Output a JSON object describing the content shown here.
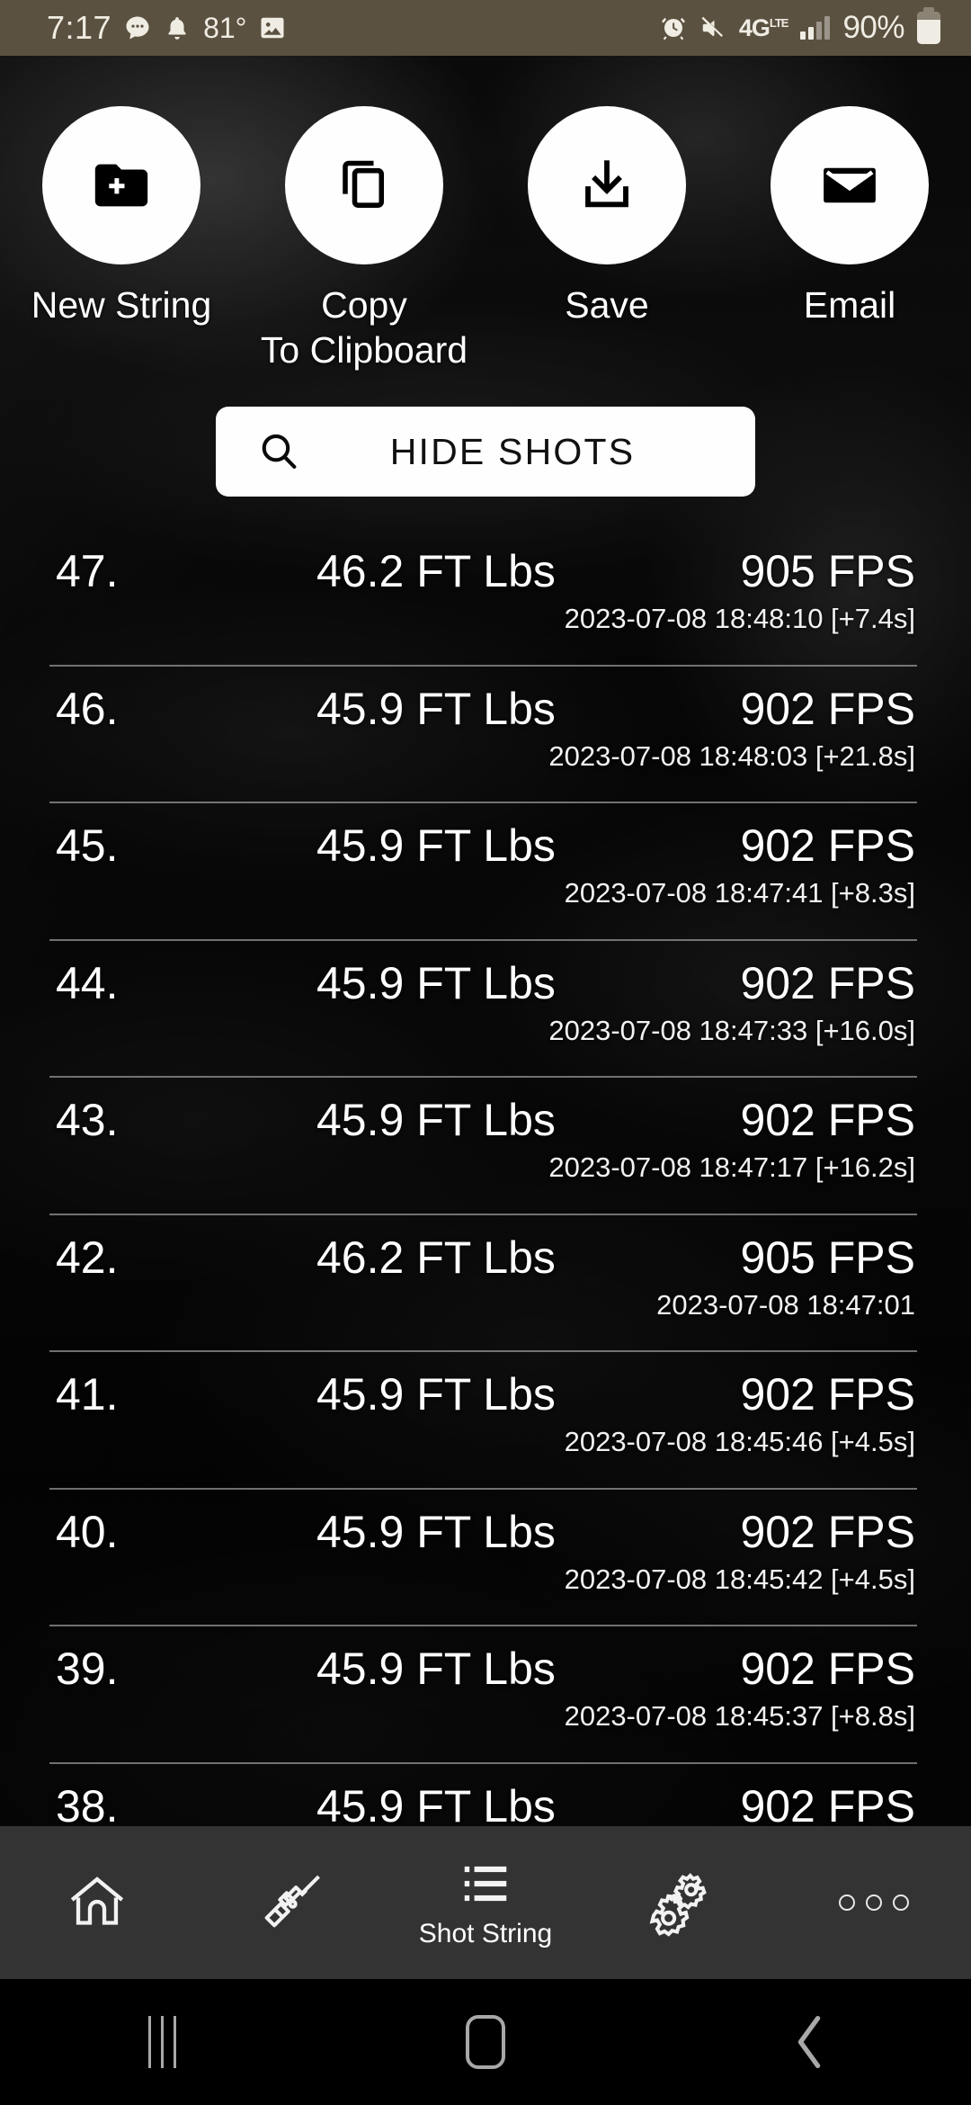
{
  "status_bar": {
    "time": "7:17",
    "temperature": "81°",
    "network": "4G",
    "network_sub": "LTE",
    "battery_percent": "90%",
    "icons": [
      "message-bubble-icon",
      "bell-icon",
      "photo-icon",
      "alarm-clock-icon",
      "mute-icon",
      "signal-bars-icon",
      "battery-icon"
    ],
    "background_color": "#5b5140",
    "text_color": "#efece3"
  },
  "actions": [
    {
      "label": "New String",
      "icon": "folder-plus-icon"
    },
    {
      "label": "Copy\nTo Clipboard",
      "icon": "copy-icon"
    },
    {
      "label": "Save",
      "icon": "download-icon"
    },
    {
      "label": "Email",
      "icon": "envelope-icon"
    }
  ],
  "hide_shots_button": {
    "label": "HIDE SHOTS",
    "icon": "search-icon",
    "background": "#fefefe",
    "text_color": "#111111"
  },
  "shot_list": {
    "columns": [
      "index",
      "energy",
      "speed",
      "timestamp"
    ],
    "energy_unit": "FT Lbs",
    "speed_unit": "FPS",
    "rows": [
      {
        "index": "47.",
        "energy": "46.2 FT Lbs",
        "speed": "905 FPS",
        "timestamp": "2023-07-08 18:48:10 [+7.4s]"
      },
      {
        "index": "46.",
        "energy": "45.9 FT Lbs",
        "speed": "902 FPS",
        "timestamp": "2023-07-08 18:48:03 [+21.8s]"
      },
      {
        "index": "45.",
        "energy": "45.9 FT Lbs",
        "speed": "902 FPS",
        "timestamp": "2023-07-08 18:47:41 [+8.3s]"
      },
      {
        "index": "44.",
        "energy": "45.9 FT Lbs",
        "speed": "902 FPS",
        "timestamp": "2023-07-08 18:47:33 [+16.0s]"
      },
      {
        "index": "43.",
        "energy": "45.9 FT Lbs",
        "speed": "902 FPS",
        "timestamp": "2023-07-08 18:47:17 [+16.2s]"
      },
      {
        "index": "42.",
        "energy": "46.2 FT Lbs",
        "speed": "905 FPS",
        "timestamp": "2023-07-08 18:47:01"
      },
      {
        "index": "41.",
        "energy": "45.9 FT Lbs",
        "speed": "902 FPS",
        "timestamp": "2023-07-08 18:45:46 [+4.5s]"
      },
      {
        "index": "40.",
        "energy": "45.9 FT Lbs",
        "speed": "902 FPS",
        "timestamp": "2023-07-08 18:45:42 [+4.5s]"
      },
      {
        "index": "39.",
        "energy": "45.9 FT Lbs",
        "speed": "902 FPS",
        "timestamp": "2023-07-08 18:45:37 [+8.8s]"
      },
      {
        "index": "38.",
        "energy": "45.9 FT Lbs",
        "speed": "902 FPS",
        "timestamp": ""
      }
    ]
  },
  "bottom_nav": {
    "background": "#333333",
    "items": [
      {
        "label": "",
        "icon": "home-icon",
        "active": false
      },
      {
        "label": "",
        "icon": "rifle-icon",
        "active": false
      },
      {
        "label": "Shot String",
        "icon": "list-icon",
        "active": true
      },
      {
        "label": "",
        "icon": "gears-icon",
        "active": false
      },
      {
        "label": "",
        "icon": "more-dots-icon",
        "active": false
      }
    ]
  },
  "android_nav": {
    "items": [
      {
        "icon": "recents-icon"
      },
      {
        "icon": "home-square-icon"
      },
      {
        "icon": "back-chevron-icon"
      }
    ]
  }
}
